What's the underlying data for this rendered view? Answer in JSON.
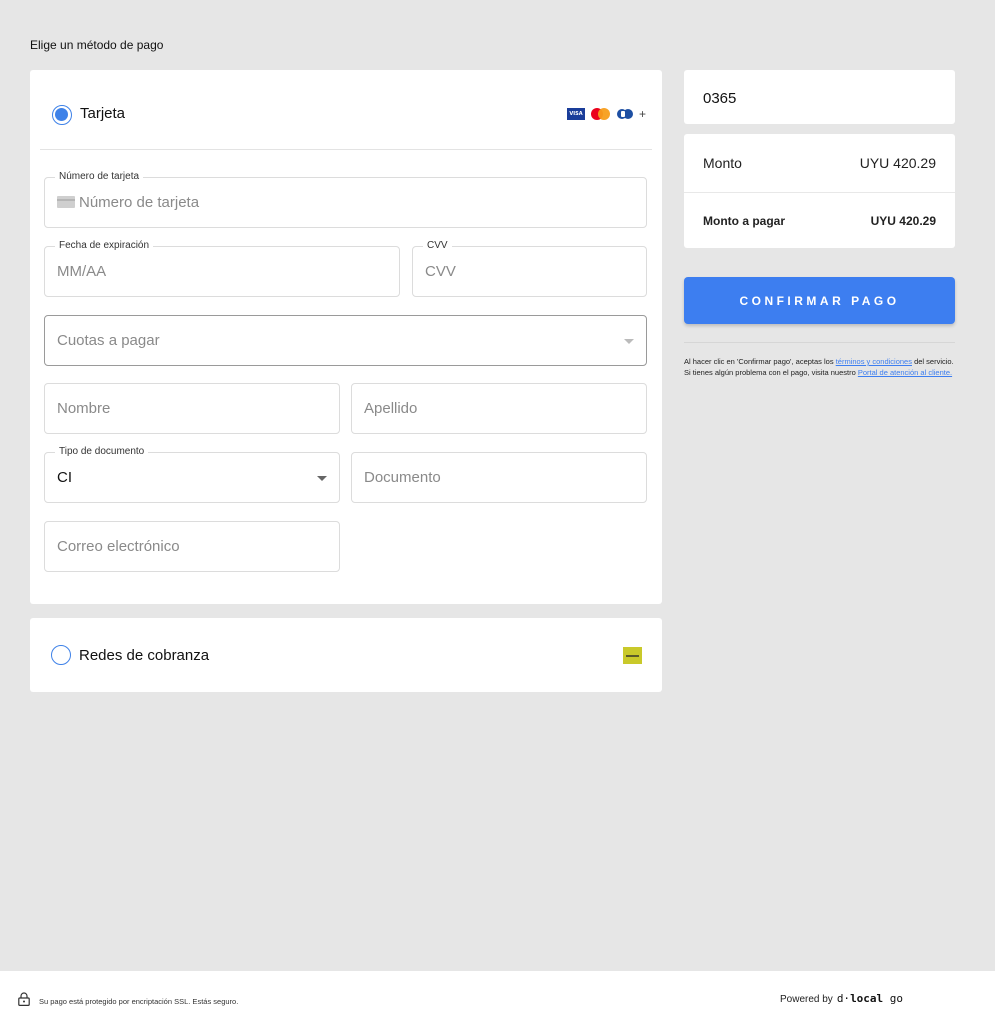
{
  "heading": "Elige un método de pago",
  "methods": {
    "card": {
      "label": "Tarjeta",
      "selected": true,
      "brands": {
        "visa": "VISA",
        "more": "+"
      }
    },
    "cash": {
      "label": "Redes de cobranza",
      "selected": false
    }
  },
  "form": {
    "card_number": {
      "legend": "Número de tarjeta",
      "placeholder": "Número de tarjeta"
    },
    "expiry": {
      "legend": "Fecha de expiración",
      "placeholder": "MM/AA"
    },
    "cvv": {
      "legend": "CVV",
      "placeholder": "CVV"
    },
    "installments": {
      "placeholder": "Cuotas a pagar"
    },
    "first_name": {
      "placeholder": "Nombre"
    },
    "last_name": {
      "placeholder": "Apellido"
    },
    "doc_type": {
      "legend": "Tipo de documento",
      "value": "CI"
    },
    "document": {
      "placeholder": "Documento"
    },
    "email": {
      "placeholder": "Correo electrónico"
    }
  },
  "summary": {
    "order_number": "0365",
    "amount_label": "Monto",
    "amount_value": "UYU 420.29",
    "total_label": "Monto a pagar",
    "total_value": "UYU 420.29"
  },
  "confirm_label": "CONFIRMAR PAGO",
  "terms": {
    "before": "Al hacer clic en 'Confirmar pago', aceptas los ",
    "link1": "términos y condiciones",
    "middle": " del servicio. Si tienes algún problema con el pago, visita nuestro ",
    "link2": "Portal de atención al cliente."
  },
  "footer": {
    "security_text": "Su pago está protegido por encriptación SSL. Estás seguro.",
    "powered_by": "Powered by",
    "brand_prefix": "d·",
    "brand_bold": "local",
    "brand_suffix": " go"
  },
  "colors": {
    "accent": "#3d7ef0",
    "background": "#e6e6e6"
  }
}
